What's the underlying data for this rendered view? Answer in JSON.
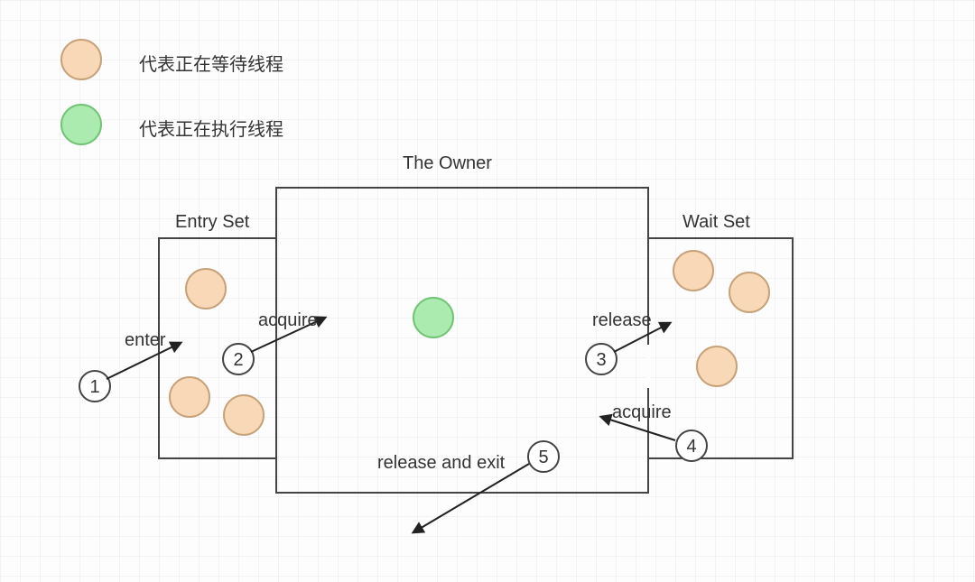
{
  "legend": {
    "waiting": "代表正在等待线程",
    "running": "代表正在执行线程"
  },
  "labels": {
    "owner": "The Owner",
    "entry": "Entry Set",
    "wait": "Wait Set"
  },
  "actions": {
    "enter": "enter",
    "acquire_from_entry": "acquire",
    "release_to_wait": "release",
    "acquire_from_wait": "acquire",
    "release_exit": "release and exit"
  },
  "markers": {
    "n1": "1",
    "n2": "2",
    "n3": "3",
    "n4": "4",
    "n5": "5"
  },
  "colors": {
    "waiting_fill": "#f8d8b6",
    "waiting_stroke": "#c6a27b",
    "running_fill": "#abebaf",
    "running_stroke": "#72c376",
    "box_stroke": "#444",
    "arrow_stroke": "#222"
  }
}
